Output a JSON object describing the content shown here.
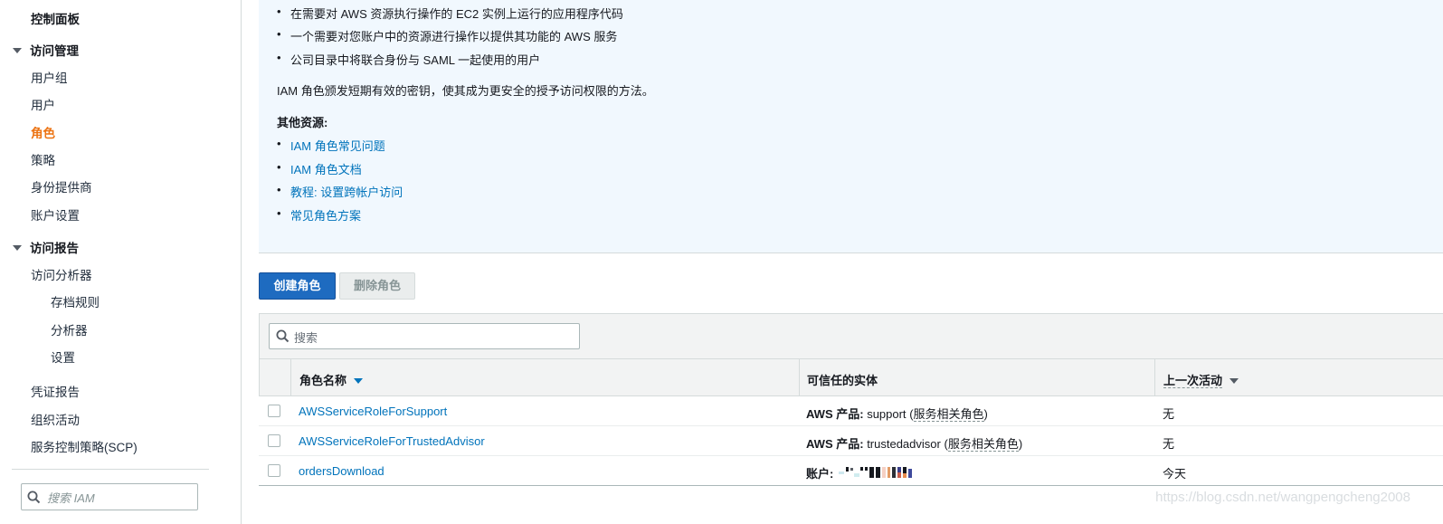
{
  "sidebar": {
    "dashboard": "控制面板",
    "access_management": {
      "label": "访问管理",
      "items": [
        "用户组",
        "用户",
        "角色",
        "策略",
        "身份提供商",
        "账户设置"
      ],
      "active": "角色"
    },
    "access_reports": {
      "label": "访问报告",
      "analyzer": "访问分析器",
      "analyzer_sub": [
        "存档规则",
        "分析器",
        "设置"
      ],
      "items": [
        "凭证报告",
        "组织活动",
        "服务控制策略(SCP)"
      ]
    },
    "search_placeholder": "搜索 IAM"
  },
  "info": {
    "bullets": [
      "在需要对 AWS 资源执行操作的 EC2 实例上运行的应用程序代码",
      "一个需要对您账户中的资源进行操作以提供其功能的 AWS 服务",
      "公司目录中将联合身份与 SAML 一起使用的用户"
    ],
    "description": "IAM 角色颁发短期有效的密钥，使其成为更安全的授予访问权限的方法。",
    "resources_title": "其他资源:",
    "links": [
      "IAM 角色常见问题",
      "IAM 角色文档",
      "教程: 设置跨帐户访问",
      "常见角色方案"
    ]
  },
  "toolbar": {
    "create_label": "创建角色",
    "delete_label": "删除角色"
  },
  "table": {
    "search_placeholder": "搜索",
    "columns": [
      "角色名称",
      "可信任的实体",
      "上一次活动"
    ],
    "rows": [
      {
        "name": "AWSServiceRoleForSupport",
        "entity_prefix": "AWS 产品:",
        "entity_value": "support",
        "entity_open": "(",
        "entity_note": "服务相关角色",
        "entity_close": ")",
        "activity": "无"
      },
      {
        "name": "AWSServiceRoleForTrustedAdvisor",
        "entity_prefix": "AWS 产品:",
        "entity_value": "trustedadvisor",
        "entity_open": "(",
        "entity_note": "服务相关角色",
        "entity_close": ")",
        "activity": "无"
      },
      {
        "name": "ordersDownload",
        "entity_prefix": "账户:",
        "activity": "今天"
      }
    ]
  },
  "colors": {
    "accent": "#ec7211",
    "primary": "#1e6bc0",
    "link": "#0073bb",
    "info_bg": "#f1f8fe"
  },
  "watermark": "https://blog.csdn.net/wangpengcheng2008"
}
